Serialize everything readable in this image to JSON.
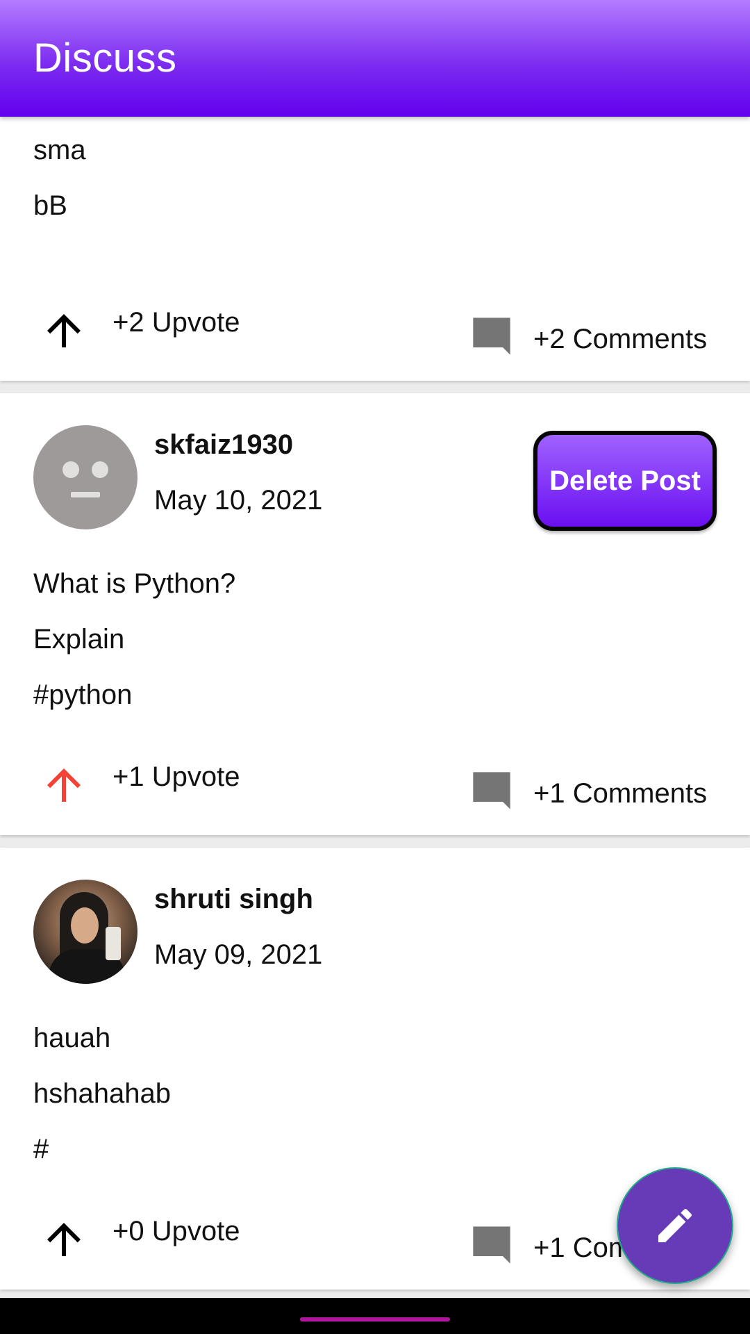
{
  "app_bar": {
    "title": "Discuss"
  },
  "posts": [
    {
      "lines": [
        "sma",
        "bB"
      ],
      "upvote_label": "+2 Upvote",
      "upvote_active": false,
      "comments_label": "+2 Comments"
    },
    {
      "username": "skfaiz1930",
      "date": "May 10, 2021",
      "avatar": "default-avatar-icon",
      "delete_label": "Delete Post",
      "lines": [
        "What is Python?",
        "Explain",
        "#python"
      ],
      "upvote_label": "+1 Upvote",
      "upvote_active": true,
      "comments_label": "+1 Comments"
    },
    {
      "username": "shruti singh",
      "date": "May 09, 2021",
      "avatar": "user-photo",
      "lines": [
        "hauah",
        "hshahahab",
        "#"
      ],
      "upvote_label": "+0 Upvote",
      "upvote_active": false,
      "comments_label": "+1 Comments"
    }
  ],
  "fab": {
    "icon": "pencil-icon"
  },
  "colors": {
    "accent": "#6200ee",
    "fab": "#673ab7",
    "upvote_active": "#f44336",
    "upvote_inactive": "#000000",
    "comment_icon": "#757575"
  }
}
